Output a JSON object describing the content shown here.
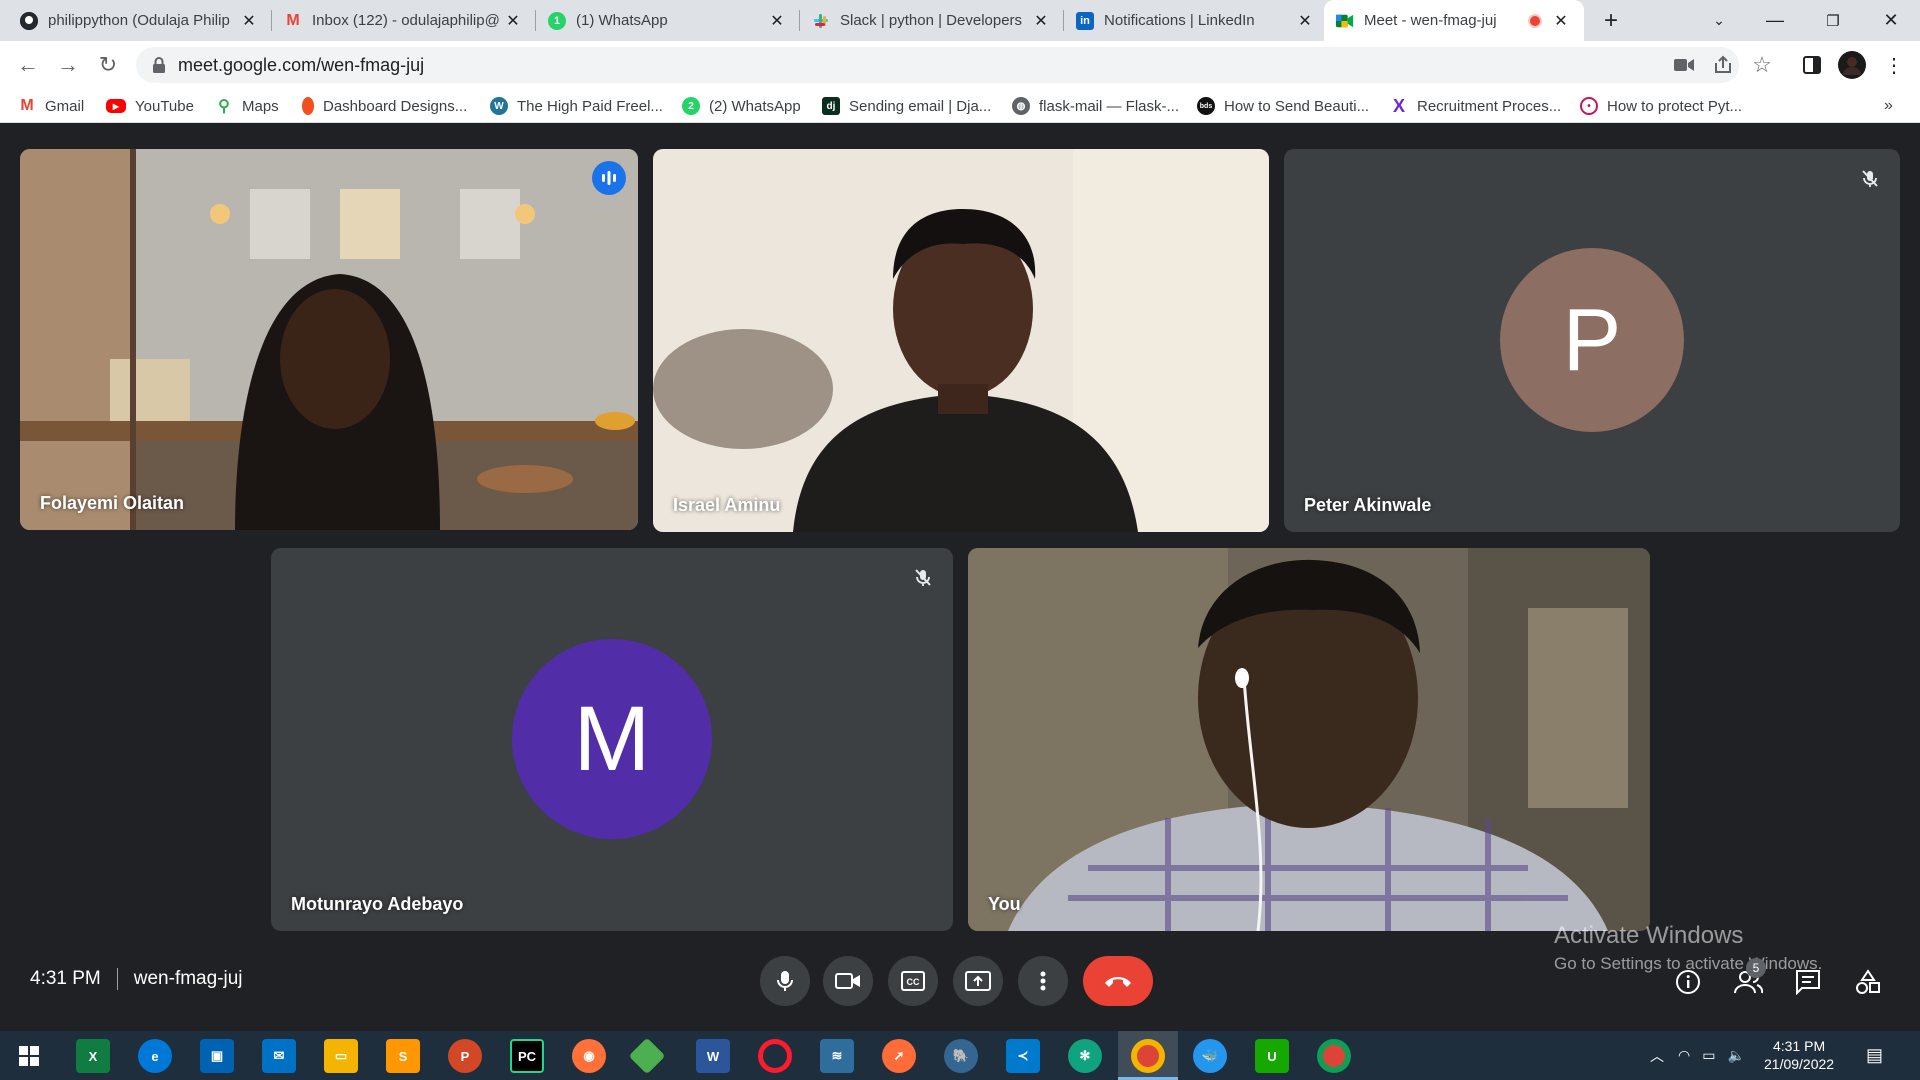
{
  "tabs": [
    {
      "title": "philippython (Odulaja Philip",
      "icon": "github-icon",
      "color": "#24292f"
    },
    {
      "title": "Inbox (122) - odulajaphilip@",
      "icon": "gmail-icon",
      "color": "#ea4335"
    },
    {
      "title": "(1) WhatsApp",
      "icon": "whatsapp-icon",
      "color": "#25d366"
    },
    {
      "title": "Slack | python | Developers",
      "icon": "slack-icon",
      "color": "#e01e5a"
    },
    {
      "title": "Notifications | LinkedIn",
      "icon": "linkedin-icon",
      "color": "#0a66c2"
    },
    {
      "title": "Meet - wen-fmag-juj",
      "icon": "meet-icon",
      "color": "#00832d",
      "active": true,
      "recording_color": "#ea4335"
    }
  ],
  "address": {
    "url": "meet.google.com/wen-fmag-juj"
  },
  "bookmarks": [
    {
      "label": "Gmail",
      "icon": "gmail-icon",
      "color": "#ea4335"
    },
    {
      "label": "YouTube",
      "icon": "youtube-icon",
      "color": "#ff0000"
    },
    {
      "label": "Maps",
      "icon": "maps-icon",
      "color": "#34a853"
    },
    {
      "label": "Dashboard Designs...",
      "icon": "figma-icon",
      "color": "#f24e1e"
    },
    {
      "label": "The High Paid Freel...",
      "icon": "wordpress-icon",
      "color": "#21759b"
    },
    {
      "label": "(2) WhatsApp",
      "icon": "whatsapp-icon",
      "color": "#25d366"
    },
    {
      "label": "Sending email | Dja...",
      "icon": "django-icon",
      "color": "#092e20"
    },
    {
      "label": "flask-mail — Flask-...",
      "icon": "globe-icon",
      "color": "#5f6368"
    },
    {
      "label": "How to Send Beauti...",
      "icon": "bds-icon",
      "color": "#111111"
    },
    {
      "label": "Recruitment Proces...",
      "icon": "x-logo-icon",
      "color": "#6d28d9"
    },
    {
      "label": "How to protect Pyt...",
      "icon": "shield-icon",
      "color": "#c2185b"
    }
  ],
  "participants": [
    {
      "name": "Folayemi Olaitan",
      "type": "video",
      "speaking": true
    },
    {
      "name": "Israel Aminu",
      "type": "video"
    },
    {
      "name": "Peter Akinwale",
      "type": "avatar",
      "initial": "P",
      "avatar_color": "#8d6e63",
      "muted": true
    },
    {
      "name": "Motunrayo Adebayo",
      "type": "avatar",
      "initial": "M",
      "avatar_color": "#512da8",
      "muted": true
    },
    {
      "name": "You",
      "type": "video"
    }
  ],
  "meeting": {
    "time": "4:31 PM",
    "code": "wen-fmag-juj",
    "people_count": "5"
  },
  "watermark": {
    "title": "Activate Windows",
    "subtitle": "Go to Settings to activate Windows."
  },
  "taskbar": {
    "apps": [
      "excel-icon",
      "edge-icon",
      "store-icon",
      "mail-icon",
      "file-explorer-icon",
      "sublime-icon",
      "powerpoint-icon",
      "pycharm-icon",
      "firefox-icon",
      "git-icon",
      "word-icon",
      "opera-icon",
      "mysql-workbench-icon",
      "postman-icon",
      "postgresql-icon",
      "vscode-icon",
      "chatgpt-icon",
      "chrome-icon",
      "docker-icon",
      "upwork-icon",
      "chrome-profile-icon"
    ],
    "time": "4:31 PM",
    "date": "21/09/2022"
  }
}
